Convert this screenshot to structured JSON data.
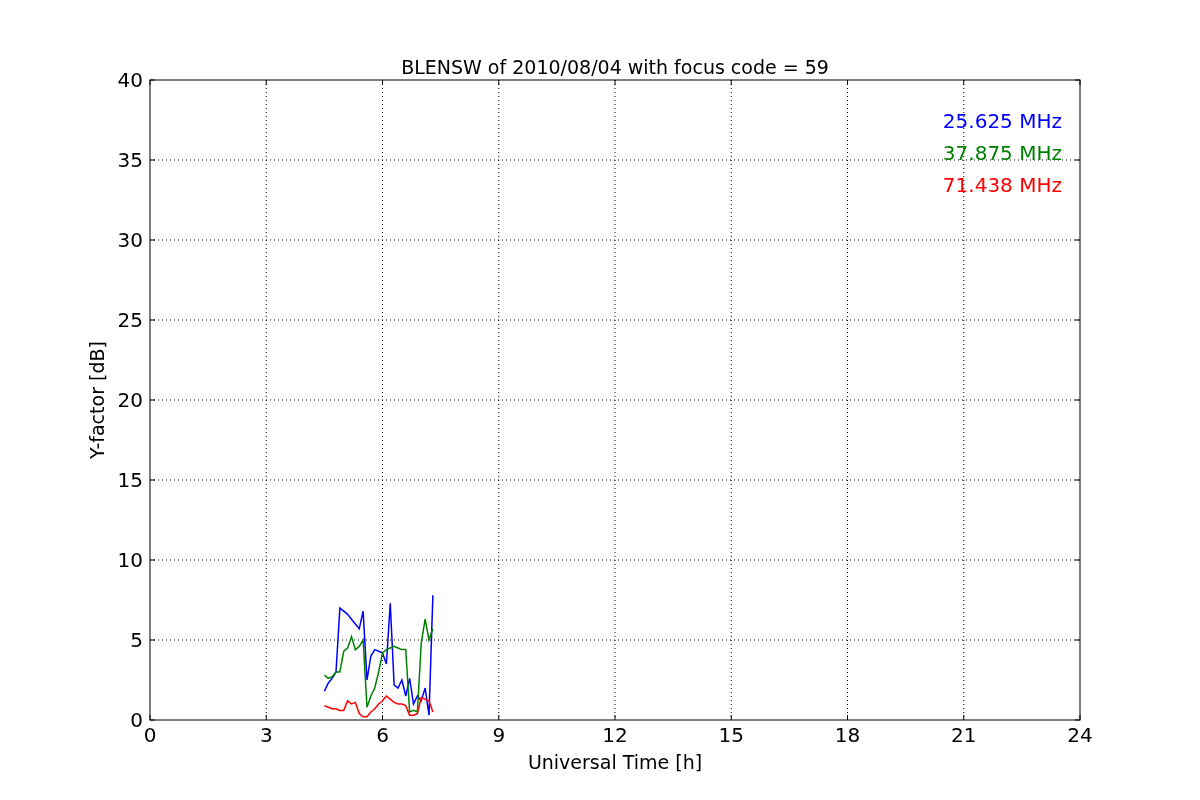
{
  "chart_data": {
    "type": "line",
    "title": "BLENSW of 2010/08/04 with focus code = 59",
    "xlabel": "Universal Time [h]",
    "ylabel": "Y-factor [dB]",
    "x": [
      4.5,
      4.6,
      4.7,
      4.8,
      4.9,
      5.0,
      5.1,
      5.2,
      5.3,
      5.4,
      5.5,
      5.6,
      5.7,
      5.8,
      5.9,
      6.0,
      6.1,
      6.2,
      6.3,
      6.4,
      6.5,
      6.6,
      6.7,
      6.8,
      6.9,
      7.0,
      7.1,
      7.2,
      7.3
    ],
    "series": [
      {
        "name": "25.625 MHz",
        "color": "#0000ff",
        "values": [
          1.8,
          2.3,
          2.6,
          3.0,
          7.0,
          6.8,
          6.6,
          6.3,
          6.0,
          5.7,
          6.8,
          2.5,
          4.0,
          4.4,
          4.3,
          4.2,
          3.5,
          7.3,
          2.2,
          2.0,
          2.5,
          1.5,
          2.6,
          1.0,
          1.5,
          1.2,
          2.0,
          0.3,
          7.8
        ]
      },
      {
        "name": "37.875 MHz",
        "color": "#008000",
        "values": [
          2.8,
          2.6,
          2.7,
          3.0,
          3.0,
          4.3,
          4.5,
          5.2,
          4.4,
          4.6,
          5.0,
          0.8,
          1.5,
          2.0,
          3.0,
          4.2,
          4.4,
          4.5,
          4.6,
          4.5,
          4.4,
          4.4,
          0.5,
          0.6,
          0.5,
          4.8,
          6.3,
          5.0,
          5.7
        ]
      },
      {
        "name": "71.438 MHz",
        "color": "#ff0000",
        "values": [
          0.9,
          0.8,
          0.7,
          0.7,
          0.6,
          0.6,
          1.2,
          1.0,
          1.1,
          0.4,
          0.2,
          0.2,
          0.5,
          0.7,
          1.0,
          1.2,
          1.5,
          1.3,
          1.1,
          1.0,
          1.0,
          0.9,
          0.3,
          0.3,
          0.4,
          1.4,
          1.3,
          1.2,
          0.5
        ]
      }
    ],
    "xlim": [
      0,
      24
    ],
    "ylim": [
      0,
      40
    ],
    "xticks": [
      0,
      3,
      6,
      9,
      12,
      15,
      18,
      21,
      24
    ],
    "yticks": [
      0,
      5,
      10,
      15,
      20,
      25,
      30,
      35,
      40
    ],
    "grid": true
  }
}
